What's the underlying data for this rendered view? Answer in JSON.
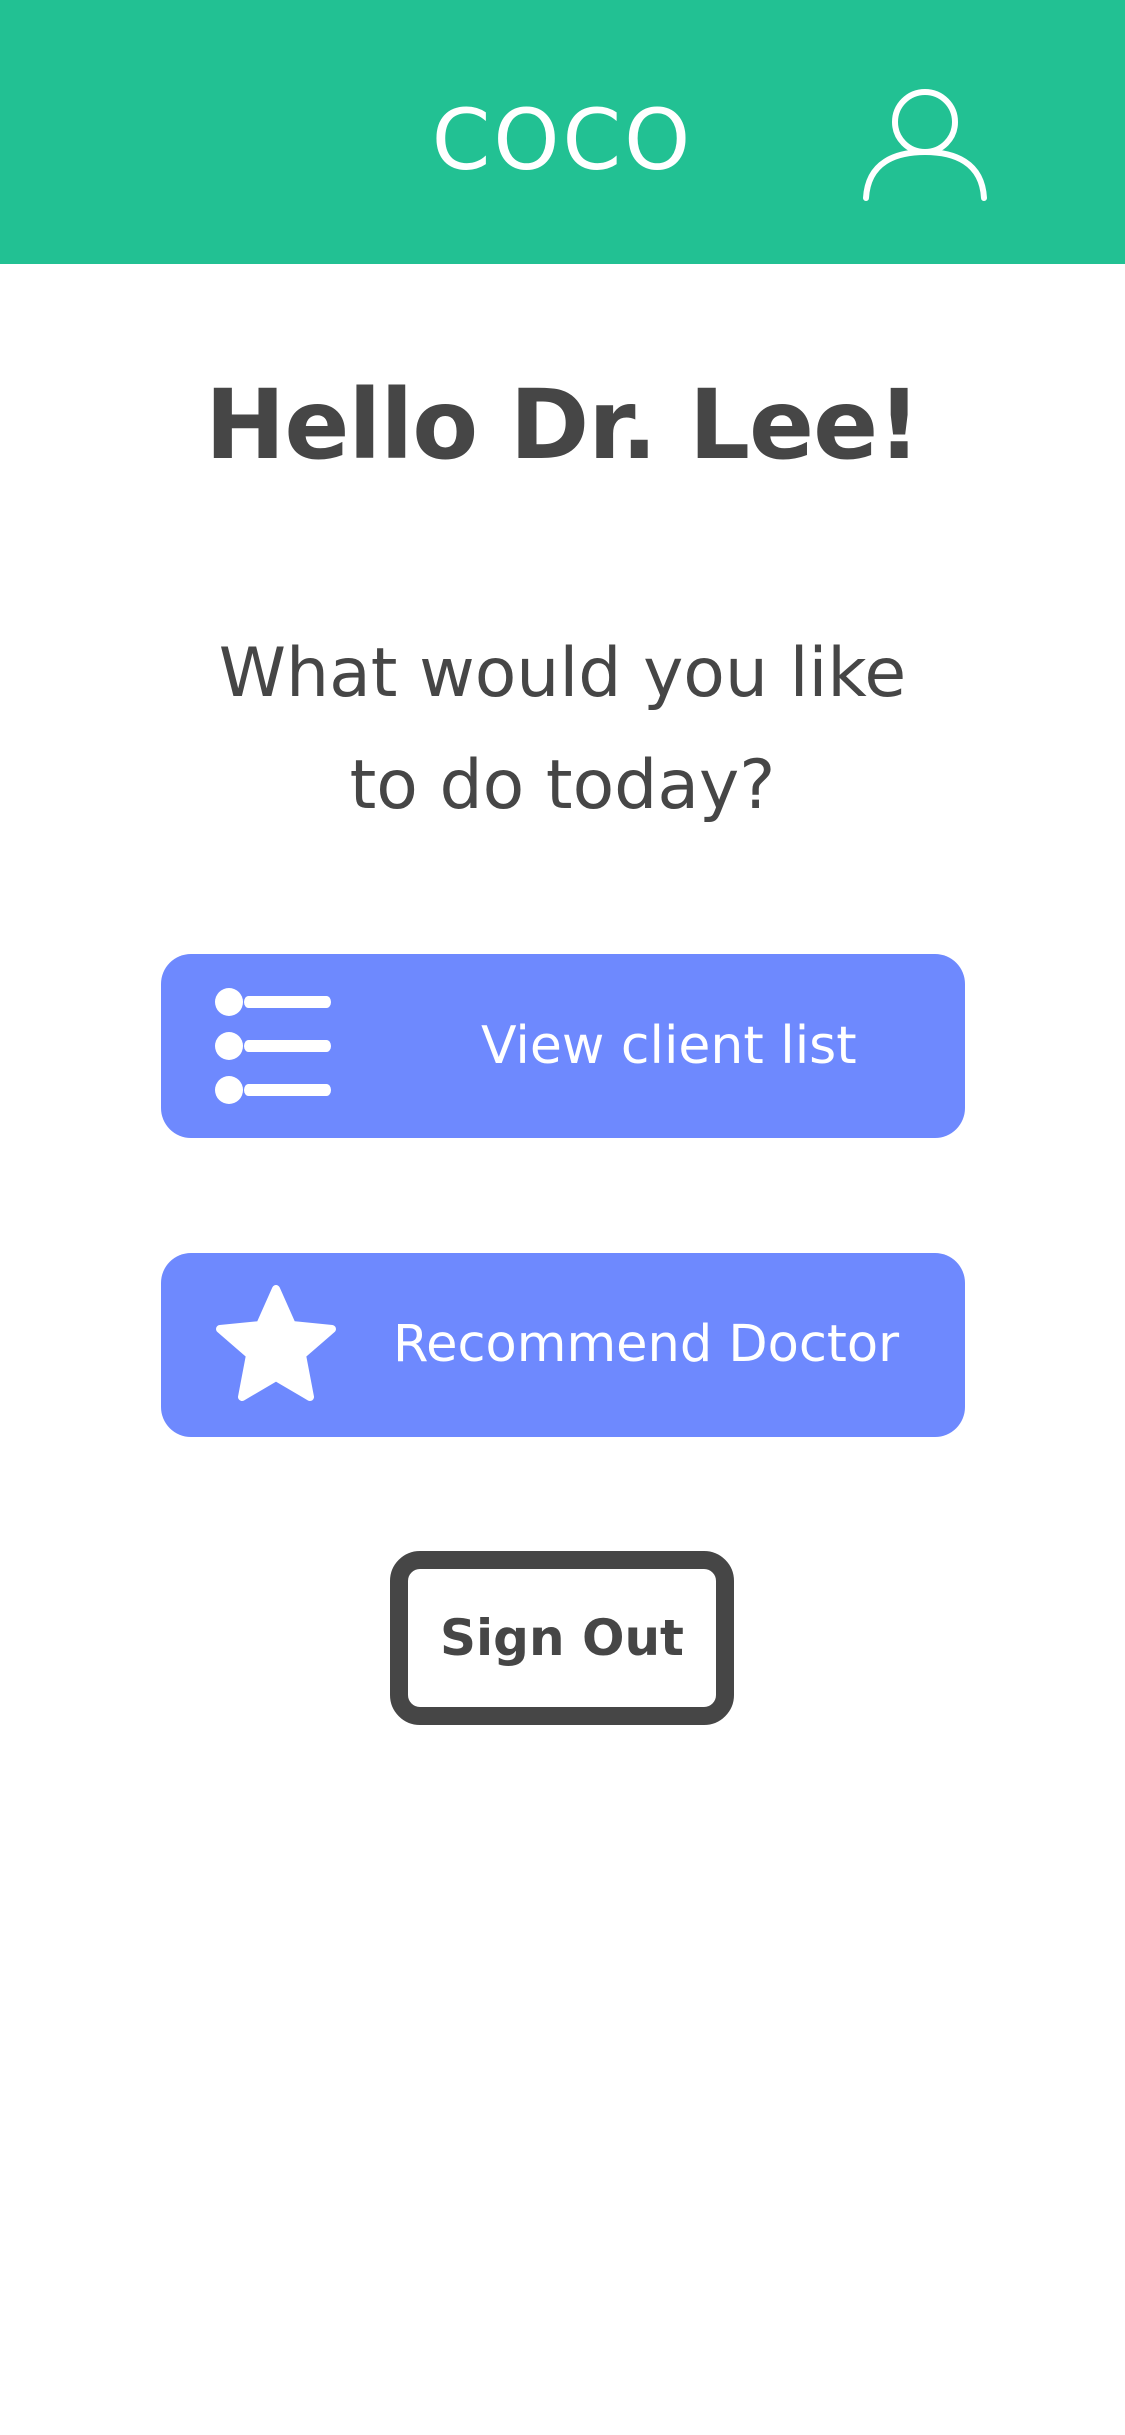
{
  "header": {
    "title": "COCO",
    "profile_icon": "user-outline-icon",
    "background_color": "#22c193"
  },
  "main": {
    "greeting": "Hello Dr. Lee!",
    "prompt_line1": "What would you like",
    "prompt_line2": "to do today?"
  },
  "actions": [
    {
      "label": "View client list",
      "icon": "list-icon",
      "color": "#6e89fe"
    },
    {
      "label": "Recommend Doctor",
      "icon": "star-icon",
      "color": "#6e89fe"
    }
  ],
  "signout": {
    "label": "Sign Out",
    "border_color": "#464646"
  }
}
